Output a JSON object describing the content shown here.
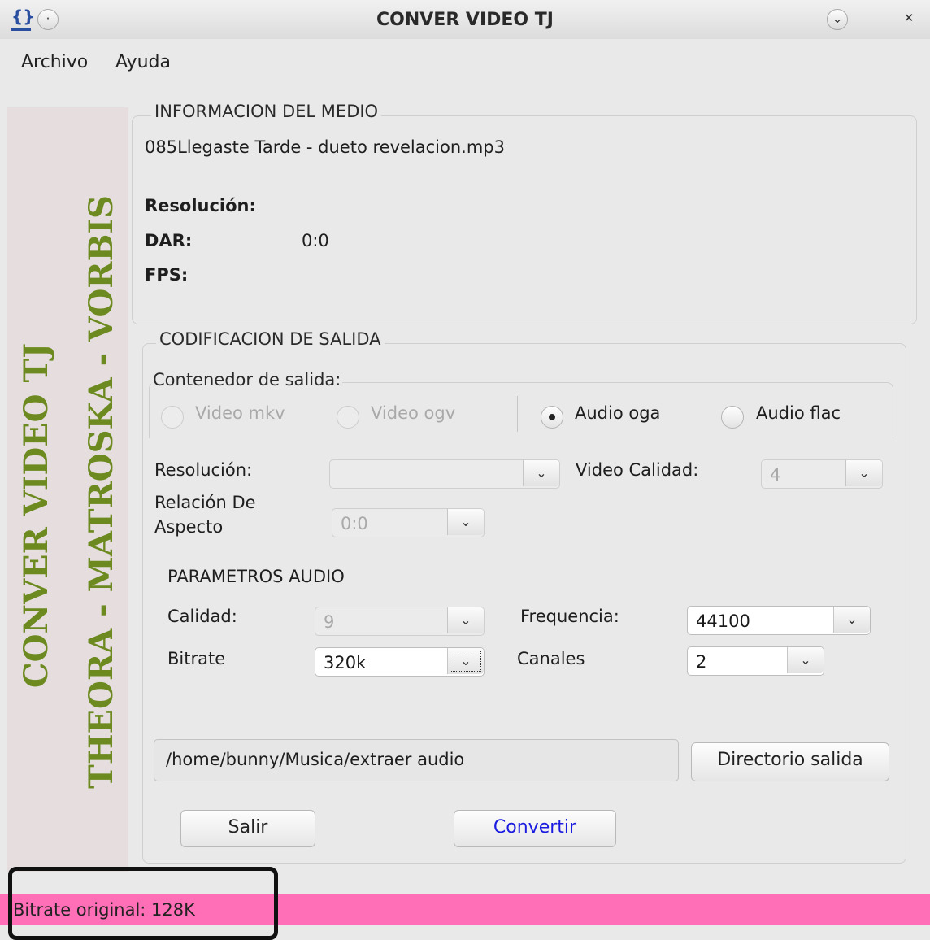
{
  "window": {
    "title": "CONVER VIDEO TJ",
    "app_icon": "{}",
    "min_glyph": "⌄",
    "close_glyph": "✕"
  },
  "menu": {
    "items": [
      "Archivo",
      "Ayuda"
    ]
  },
  "banner": {
    "line1": "CONVER VIDEO TJ",
    "line2": "THEORA - MATROSKA - VORBIS",
    "color": "#6c8a1f"
  },
  "media_info": {
    "legend": "INFORMACION DEL MEDIO",
    "filename": "085Llegaste Tarde - dueto revelacion.mp3",
    "resolution_label": "Resolución:",
    "dar_label": "DAR:",
    "dar_value": "0:0",
    "fps_label": "FPS:"
  },
  "output": {
    "legend": "CODIFICACION DE SALIDA",
    "container_legend": "Contenedor de salida:",
    "radios": [
      {
        "label": "Video mkv",
        "selected": false,
        "enabled": false
      },
      {
        "label": "Video ogv",
        "selected": false,
        "enabled": false
      },
      {
        "label": "Audio oga",
        "selected": true,
        "enabled": true
      },
      {
        "label": "Audio flac",
        "selected": false,
        "enabled": true
      }
    ],
    "resolution_label": "Resolución:",
    "resolution_value": "",
    "video_quality_label": "Video Calidad:",
    "video_quality_value": "4",
    "aspect_label_1": "Relación De",
    "aspect_label_2": "Aspecto",
    "aspect_value": "0:0",
    "audio_params_title": "PARAMETROS AUDIO",
    "quality_label": "Calidad:",
    "quality_value": "9",
    "frequency_label": "Frequencia:",
    "frequency_value": "44100",
    "bitrate_label": "Bitrate",
    "bitrate_value": "320k",
    "channels_label": "Canales",
    "channels_value": "2",
    "output_dir": "/home/bunny/Musica/extraer audio",
    "output_dir_button": "Directorio salida",
    "exit_button": "Salir",
    "convert_button": "Convertir",
    "convert_color": "#1a1ae0"
  },
  "status": {
    "text": "Bitrate original: 128K",
    "color": "#ff6fb7"
  },
  "icons": {
    "dropdown": "chevron-down-icon"
  }
}
